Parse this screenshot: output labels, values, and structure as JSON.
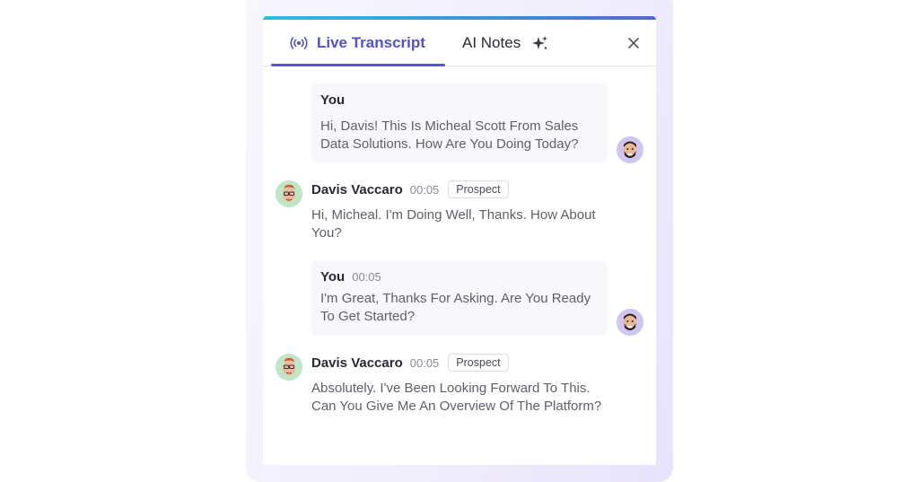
{
  "tabs": {
    "live_transcript": {
      "label": "Live Transcript",
      "icon": "broadcast-icon",
      "active": true
    },
    "ai_notes": {
      "label": "AI Notes",
      "icon": "sparkle-icon",
      "active": false
    }
  },
  "close_icon": "close-icon",
  "colors": {
    "accent": "#5551c4",
    "top_bar_start": "#2fbde2",
    "top_bar_end": "#5568cf",
    "you_bubble_bg": "#f8f7fc",
    "you_avatar_bg": "#cfc6ef",
    "prospect_avatar_bg": "#bfe6c5"
  },
  "messages": [
    {
      "speaker": "You",
      "time": "",
      "text": "Hi, Davis! This Is Micheal Scott From Sales Data Solutions. How Are You Doing Today?"
    },
    {
      "speaker": "Davis Vaccaro",
      "time": "00:05",
      "badge": "Prospect",
      "text": "Hi, Micheal. I'm Doing Well, Thanks. How About You?"
    },
    {
      "speaker": "You",
      "time": "00:05",
      "text": "I'm Great, Thanks For Asking. Are You Ready To Get Started?"
    },
    {
      "speaker": "Davis Vaccaro",
      "time": "00:05",
      "badge": "Prospect",
      "text": "Absolutely. I've Been Looking Forward To This. Can You Give Me An Overview Of The Platform?"
    }
  ]
}
